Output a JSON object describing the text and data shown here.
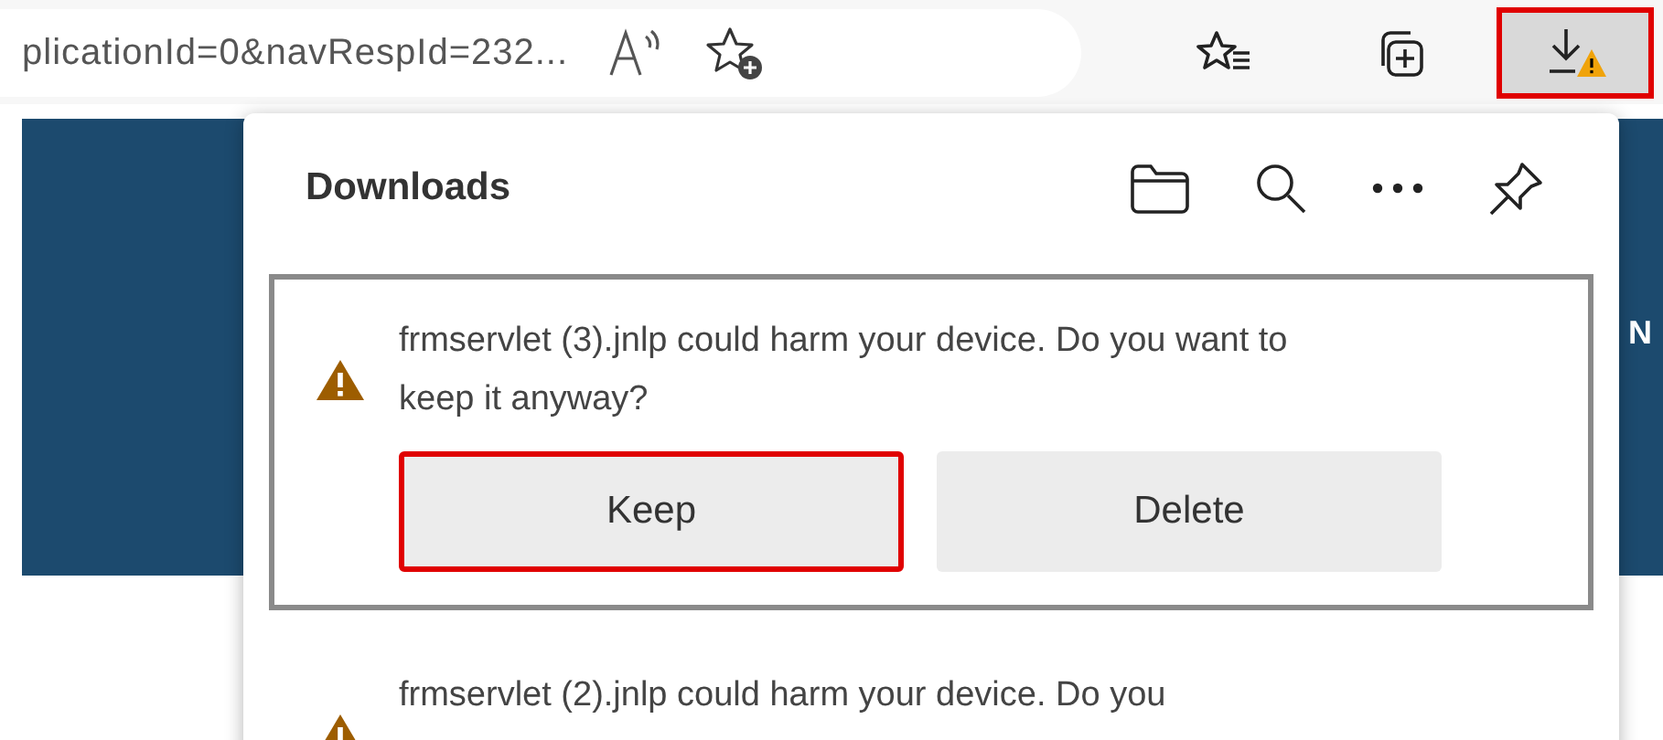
{
  "address_bar": {
    "url": "plicationId=0&navRespId=232..."
  },
  "toolbar": {
    "buttons": [
      {
        "kind": "favorites",
        "highlighted": false
      },
      {
        "kind": "collections",
        "highlighted": false
      },
      {
        "kind": "downloads",
        "highlighted": true
      }
    ]
  },
  "page": {
    "edge_text": "N"
  },
  "downloads": {
    "title": "Downloads",
    "items": [
      {
        "message": "frmservlet (3).jnlp could harm your device. Do you want to keep it anyway?",
        "focused": true,
        "actions": [
          {
            "label": "Keep",
            "highlighted": true
          },
          {
            "label": "Delete",
            "highlighted": false
          }
        ]
      },
      {
        "message": "frmservlet (2).jnlp could harm your device. Do you",
        "focused": false
      }
    ]
  }
}
